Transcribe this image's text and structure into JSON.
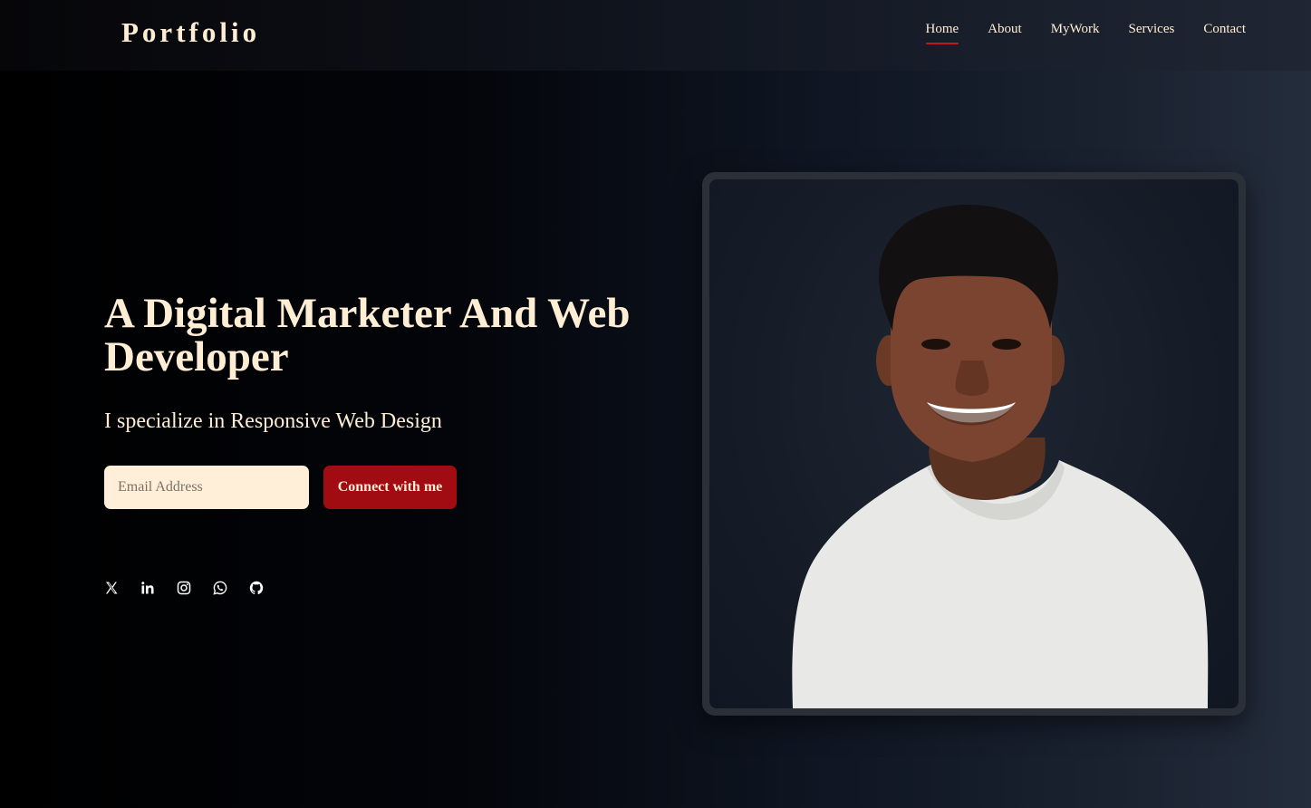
{
  "brand": {
    "logo": "Portfolio"
  },
  "nav": {
    "items": [
      {
        "label": "Home",
        "active": true
      },
      {
        "label": "About",
        "active": false
      },
      {
        "label": "MyWork",
        "active": false
      },
      {
        "label": "Services",
        "active": false
      },
      {
        "label": "Contact",
        "active": false
      }
    ]
  },
  "hero": {
    "title": "A Digital Marketer And Web Developer",
    "subtitle": "I specialize in Responsive Web Design",
    "email_placeholder": "Email Address",
    "cta_label": "Connect with me"
  },
  "socials": [
    {
      "icon": "x-twitter-icon"
    },
    {
      "icon": "linkedin-icon"
    },
    {
      "icon": "instagram-icon"
    },
    {
      "icon": "whatsapp-icon"
    },
    {
      "icon": "github-icon"
    }
  ],
  "colors": {
    "accent": "#a10c12",
    "text": "#ffedd4",
    "active_underline": "#c8141e"
  }
}
